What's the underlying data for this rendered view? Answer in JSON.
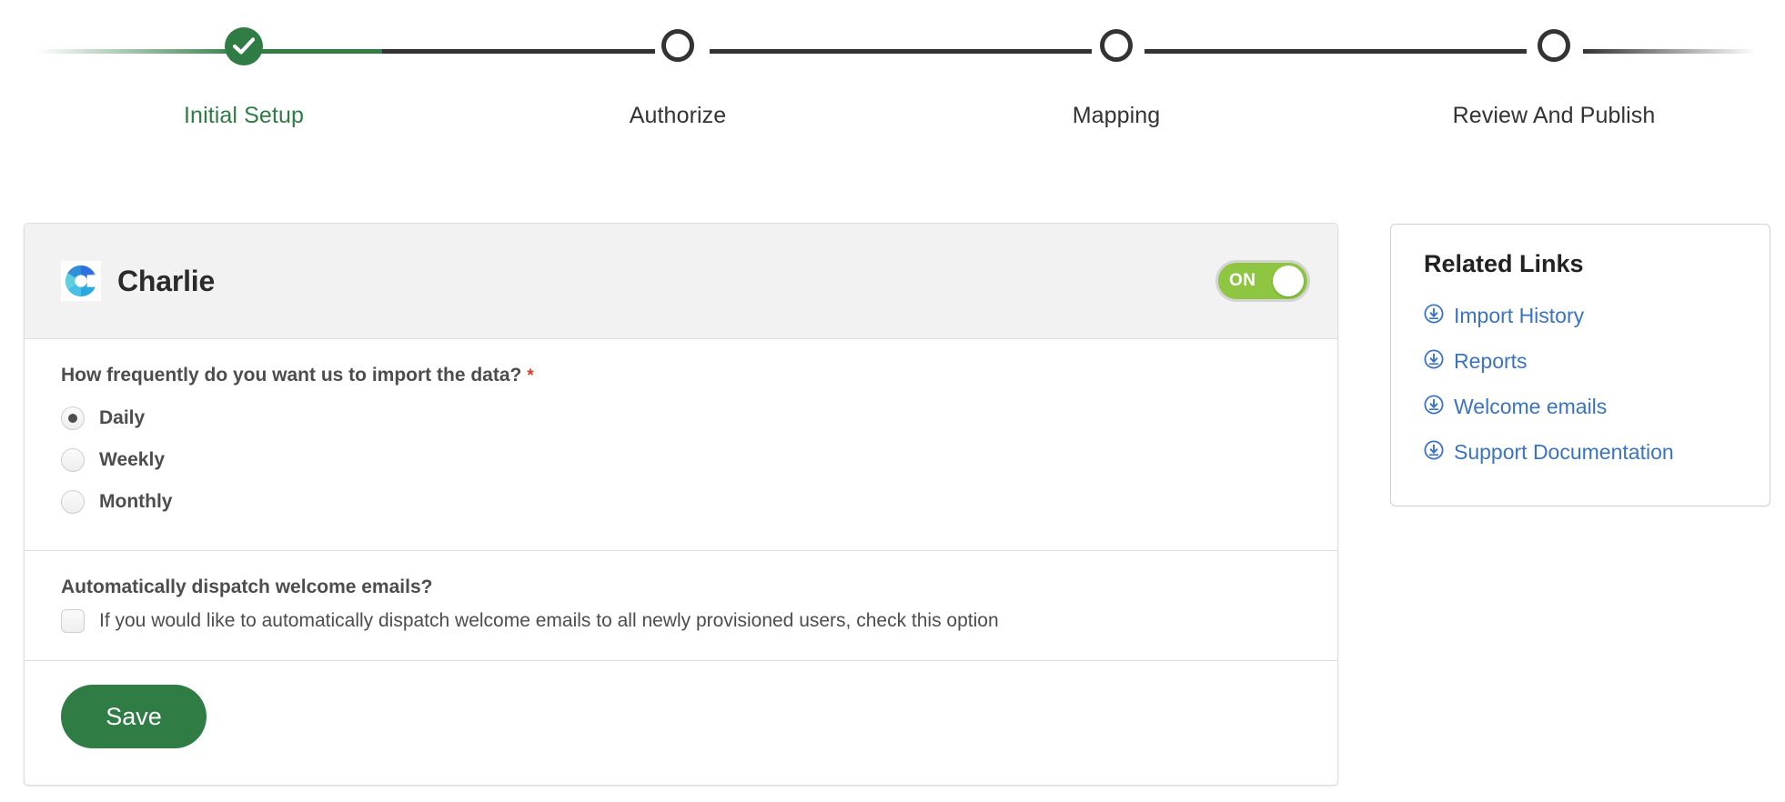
{
  "stepper": {
    "steps": [
      {
        "label": "Initial Setup",
        "state": "completed",
        "icon": "check-icon"
      },
      {
        "label": "Authorize",
        "state": "upcoming",
        "icon": "circle-icon"
      },
      {
        "label": "Mapping",
        "state": "upcoming",
        "icon": "circle-icon"
      },
      {
        "label": "Review And Publish",
        "state": "upcoming",
        "icon": "circle-icon"
      }
    ],
    "active_color": "#2f7c45",
    "inactive_color": "#333333"
  },
  "card": {
    "brand_name": "Charlie",
    "brand_logo_icon": "charlie-logo-icon",
    "toggle": {
      "label": "ON",
      "state": "on",
      "color": "#8ec642"
    },
    "frequency": {
      "question": "How frequently do you want us to import the data?",
      "required_marker": "*",
      "selected": "Daily",
      "options": [
        {
          "label": "Daily",
          "checked": true
        },
        {
          "label": "Weekly",
          "checked": false
        },
        {
          "label": "Monthly",
          "checked": false
        }
      ]
    },
    "welcome_emails": {
      "question": "Automatically dispatch welcome emails?",
      "checkbox_label": "If you would like to automatically dispatch welcome emails to all newly provisioned users, check this option",
      "checked": false
    },
    "save_label": "Save",
    "save_color": "#2f7c45"
  },
  "related_links": {
    "title": "Related Links",
    "link_color": "#3b73c4",
    "items": [
      {
        "label": "Import History",
        "icon": "download-circle-icon"
      },
      {
        "label": "Reports",
        "icon": "download-circle-icon"
      },
      {
        "label": "Welcome emails",
        "icon": "download-circle-icon"
      },
      {
        "label": "Support Documentation",
        "icon": "download-circle-icon"
      }
    ]
  }
}
